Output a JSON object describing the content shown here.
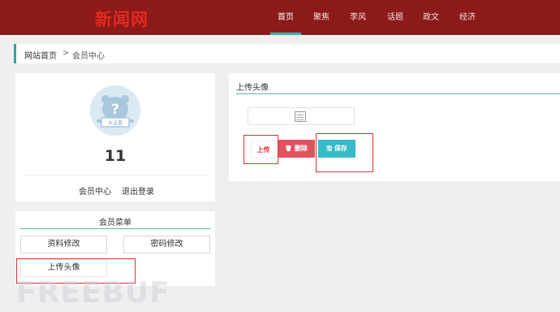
{
  "header": {
    "logo": "新闻网",
    "nav": [
      {
        "label": "首页",
        "active": true
      },
      {
        "label": "聚焦",
        "active": false
      },
      {
        "label": "李风",
        "active": false
      },
      {
        "label": "话题",
        "active": false
      },
      {
        "label": "政文",
        "active": false
      },
      {
        "label": "经济",
        "active": false
      }
    ]
  },
  "breadcrumb": {
    "home": "网站首页",
    "separator": ">",
    "current": "会员中心"
  },
  "profile": {
    "avatar_icon": "default-avatar-bear",
    "avatar_label": "未设置",
    "username": "11",
    "links": [
      "会员中心",
      "退出登录"
    ]
  },
  "menu": {
    "title": "会员菜单",
    "items": [
      "资料修改",
      "密码修改",
      "上传头像"
    ]
  },
  "panel": {
    "title": "上传头像",
    "buttons": {
      "upload": "上传",
      "delete": "删除",
      "save": "保存"
    }
  },
  "watermark": "FREEBUF",
  "colors": {
    "header_bg": "#8c1a18",
    "logo": "#e02a22",
    "accent": "#35b1a6",
    "delete": "#e0525e",
    "save": "#36b9c8",
    "highlight_box": "#e03030"
  }
}
